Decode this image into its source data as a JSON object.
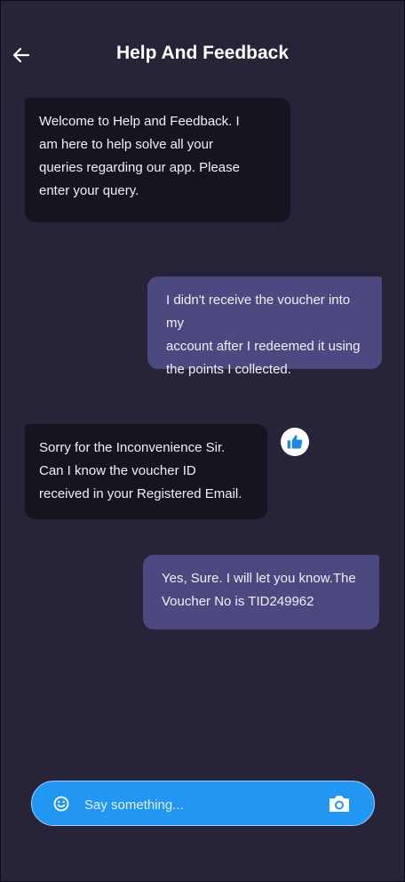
{
  "header": {
    "title": "Help And Feedback",
    "back_icon": "arrow-left-icon"
  },
  "messages": [
    {
      "sender": "bot",
      "lines": [
        "Welcome to Help and Feedback. I",
        "am here to help solve all your",
        "queries regarding our app. Please",
        "enter your query."
      ]
    },
    {
      "sender": "user",
      "lines": [
        "I didn't receive the voucher into my",
        "account after I redeemed it using",
        "the points I collected."
      ]
    },
    {
      "sender": "bot",
      "lines": [
        "Sorry for the Inconvenience Sir.",
        "Can I know the voucher ID",
        "received in your Registered Email."
      ],
      "reaction_icon": "thumbs-up-icon"
    },
    {
      "sender": "user",
      "lines": [
        "Yes, Sure. I will let you know.The",
        "Voucher No is TID249962"
      ]
    }
  ],
  "composer": {
    "placeholder": "Say something...",
    "emoji_icon": "smiley-icon",
    "camera_icon": "camera-icon"
  },
  "colors": {
    "background": "#27243a",
    "bot_bubble": "#16141f",
    "user_bubble": "#4c4880",
    "composer": "#2196f3"
  }
}
